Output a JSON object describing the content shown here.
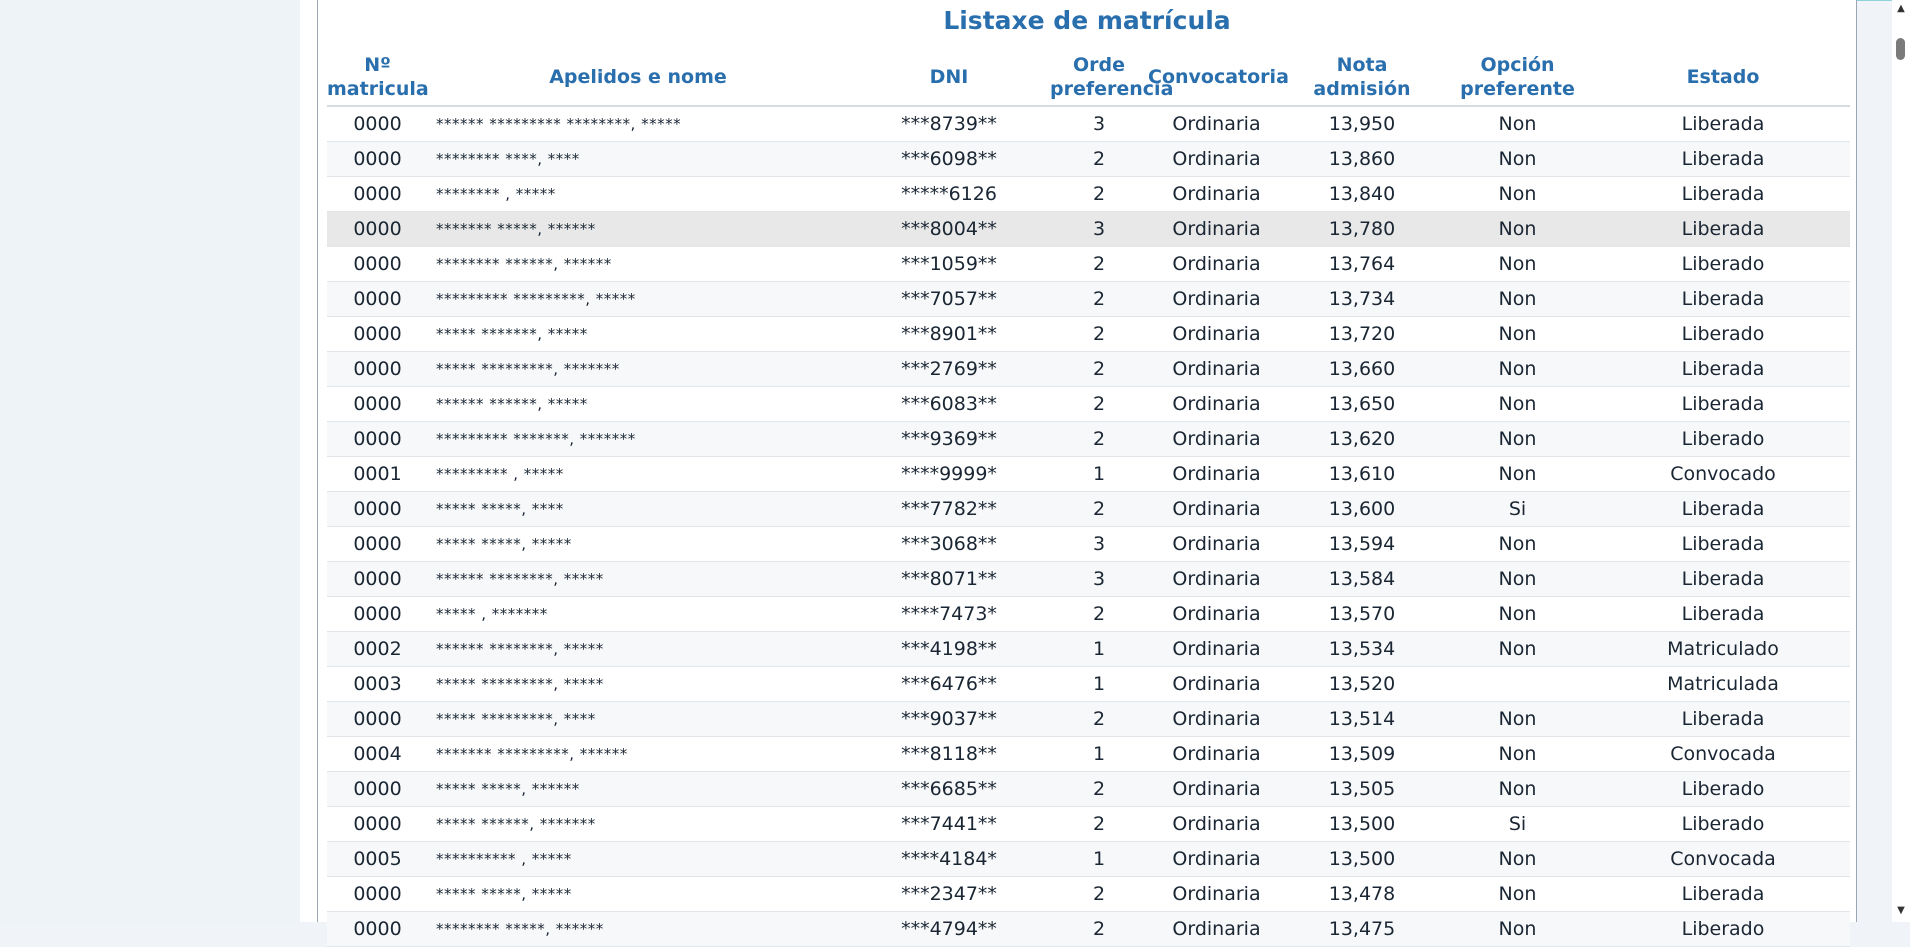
{
  "title": "Listaxe de matrícula",
  "columns": [
    {
      "line1": "Nº",
      "line2": "matricula"
    },
    {
      "line1": "Apelidos e nome",
      "line2": ""
    },
    {
      "line1": "DNI",
      "line2": ""
    },
    {
      "line1": "Orde",
      "line2": "preferencia"
    },
    {
      "line1": "Convocatoria",
      "line2": ""
    },
    {
      "line1": "Nota admisión",
      "line2": ""
    },
    {
      "line1": "Opción",
      "line2": "preferente"
    },
    {
      "line1": "Estado",
      "line2": ""
    }
  ],
  "rows": [
    [
      "0000",
      "****** ********* ********, *****",
      "***8739**",
      "3",
      "Ordinaria",
      "13,950",
      "Non",
      "Liberada"
    ],
    [
      "0000",
      "******** ****, ****",
      "***6098**",
      "2",
      "Ordinaria",
      "13,860",
      "Non",
      "Liberada"
    ],
    [
      "0000",
      "******** , *****",
      "*****6126",
      "2",
      "Ordinaria",
      "13,840",
      "Non",
      "Liberada"
    ],
    [
      "0000",
      "******* *****, ******",
      "***8004**",
      "3",
      "Ordinaria",
      "13,780",
      "Non",
      "Liberada"
    ],
    [
      "0000",
      "******** ******, ******",
      "***1059**",
      "2",
      "Ordinaria",
      "13,764",
      "Non",
      "Liberado"
    ],
    [
      "0000",
      "********* *********, *****",
      "***7057**",
      "2",
      "Ordinaria",
      "13,734",
      "Non",
      "Liberada"
    ],
    [
      "0000",
      "***** *******, *****",
      "***8901**",
      "2",
      "Ordinaria",
      "13,720",
      "Non",
      "Liberado"
    ],
    [
      "0000",
      "***** *********, *******",
      "***2769**",
      "2",
      "Ordinaria",
      "13,660",
      "Non",
      "Liberada"
    ],
    [
      "0000",
      "****** ******, *****",
      "***6083**",
      "2",
      "Ordinaria",
      "13,650",
      "Non",
      "Liberada"
    ],
    [
      "0000",
      "********* *******, *******",
      "***9369**",
      "2",
      "Ordinaria",
      "13,620",
      "Non",
      "Liberado"
    ],
    [
      "0001",
      "********* , *****",
      "****9999*",
      "1",
      "Ordinaria",
      "13,610",
      "Non",
      "Convocado"
    ],
    [
      "0000",
      "***** *****, ****",
      "***7782**",
      "2",
      "Ordinaria",
      "13,600",
      "Si",
      "Liberada"
    ],
    [
      "0000",
      "***** *****, *****",
      "***3068**",
      "3",
      "Ordinaria",
      "13,594",
      "Non",
      "Liberada"
    ],
    [
      "0000",
      "****** ********, *****",
      "***8071**",
      "3",
      "Ordinaria",
      "13,584",
      "Non",
      "Liberada"
    ],
    [
      "0000",
      "***** , *******",
      "****7473*",
      "2",
      "Ordinaria",
      "13,570",
      "Non",
      "Liberada"
    ],
    [
      "0002",
      "****** ********, *****",
      "***4198**",
      "1",
      "Ordinaria",
      "13,534",
      "Non",
      "Matriculado"
    ],
    [
      "0003",
      "***** *********, *****",
      "***6476**",
      "1",
      "Ordinaria",
      "13,520",
      "",
      "Matriculada"
    ],
    [
      "0000",
      "***** *********, ****",
      "***9037**",
      "2",
      "Ordinaria",
      "13,514",
      "Non",
      "Liberada"
    ],
    [
      "0004",
      "******* *********, ******",
      "***8118**",
      "1",
      "Ordinaria",
      "13,509",
      "Non",
      "Convocada"
    ],
    [
      "0000",
      "***** *****, ******",
      "***6685**",
      "2",
      "Ordinaria",
      "13,505",
      "Non",
      "Liberado"
    ],
    [
      "0000",
      "***** ******, *******",
      "***7441**",
      "2",
      "Ordinaria",
      "13,500",
      "Si",
      "Liberado"
    ],
    [
      "0005",
      "********** , *****",
      "****4184*",
      "1",
      "Ordinaria",
      "13,500",
      "Non",
      "Convocada"
    ],
    [
      "0000",
      "***** *****, *****",
      "***2347**",
      "2",
      "Ordinaria",
      "13,478",
      "Non",
      "Liberada"
    ],
    [
      "0000",
      "******** *****, ******",
      "***4794**",
      "2",
      "Ordinaria",
      "13,475",
      "Non",
      "Liberado"
    ]
  ],
  "highlighted_row": 3,
  "colors": {
    "header": "#2a6fad",
    "row_alt": "#f7f8f9",
    "row_highlight": "#e8e8e8"
  }
}
